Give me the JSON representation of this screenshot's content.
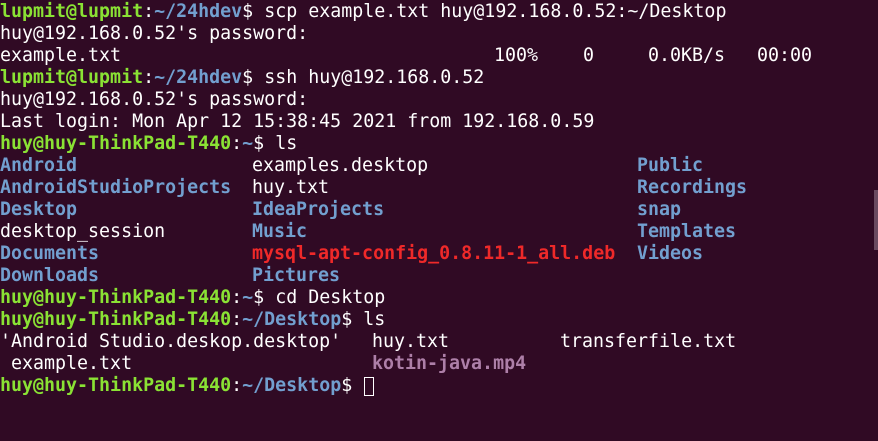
{
  "terminal": {
    "prompt_local_user": "lupmit@lupmit",
    "prompt_local_path": "~/24hdev",
    "prompt_remote_user": "huy@huy-ThinkPad-T440",
    "prompt_home_path": "~",
    "prompt_desktop_path": "~/Desktop",
    "prompt_symbol": "$ ",
    "cmd_scp": "scp example.txt huy@192.168.0.52:~/Desktop",
    "password_prompt": "huy@192.168.0.52's password:",
    "scp_progress": {
      "file": "example.txt",
      "percent": "100%",
      "size": "0",
      "rate": "0.0KB/s",
      "time": "00:00"
    },
    "cmd_ssh": "ssh huy@192.168.0.52",
    "last_login": "Last login: Mon Apr 12 15:38:45 2021 from 192.168.0.59",
    "cmd_ls": "ls",
    "home_listing": {
      "col1": [
        "Android",
        "AndroidStudioProjects",
        "Desktop",
        "desktop_session",
        "Documents",
        "Downloads"
      ],
      "col2": [
        "examples.desktop",
        "huy.txt",
        "IdeaProjects",
        "Music",
        "mysql-apt-config_0.8.11-1_all.deb",
        "Pictures"
      ],
      "col3": [
        "Public",
        "Recordings",
        "snap",
        "Templates",
        "Videos"
      ]
    },
    "cmd_cd": "cd Desktop",
    "desktop_listing": {
      "row1": [
        "'Android Studio.deskop.desktop'",
        "huy.txt",
        "transferfile.txt"
      ],
      "row2": [
        " example.txt",
        "kotin-java.mp4"
      ]
    }
  }
}
